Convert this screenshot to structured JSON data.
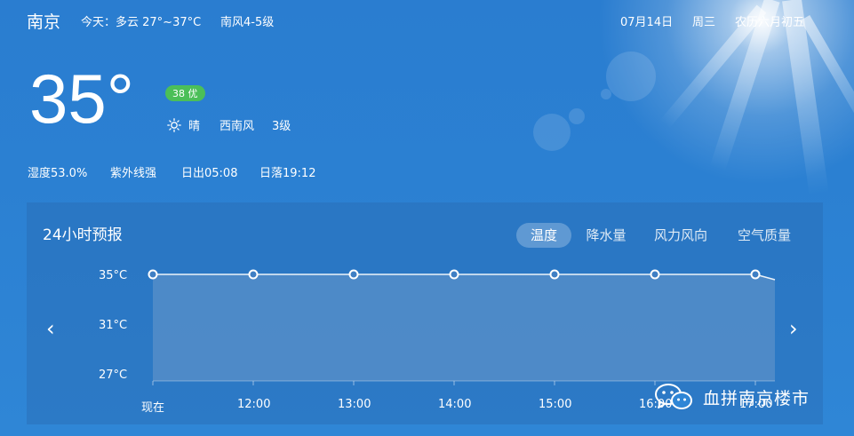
{
  "header": {
    "city": "南京",
    "today_forecast": "今天：多云 27°~37°C",
    "today_wind": "南风4-5级",
    "date": "07月14日",
    "weekday": "周三",
    "lunar_date": "农历六月初五"
  },
  "current": {
    "temperature": "35°",
    "aqi_badge": "38 优",
    "condition": "晴",
    "wind_direction": "西南风",
    "wind_level": "3级",
    "humidity": "湿度53.0%",
    "uv": "紫外线强",
    "sunrise": "日出05:08",
    "sunset": "日落19:12"
  },
  "forecast_panel": {
    "title": "24小时预报",
    "tabs": [
      "温度",
      "降水量",
      "风力风向",
      "空气质量"
    ],
    "active_tab": "温度",
    "prev_arrow": "‹",
    "next_arrow": "›"
  },
  "chart_data": {
    "type": "area",
    "x": [
      "现在",
      "12:00",
      "13:00",
      "14:00",
      "15:00",
      "16:00",
      "17:00"
    ],
    "values": [
      35,
      35,
      35,
      35,
      35,
      35,
      35
    ],
    "y_ticks": [
      "35°C",
      "31°C",
      "27°C"
    ],
    "ylim": [
      27,
      35
    ],
    "unit": "°C"
  },
  "watermark": {
    "text": "血拼南京楼市"
  }
}
